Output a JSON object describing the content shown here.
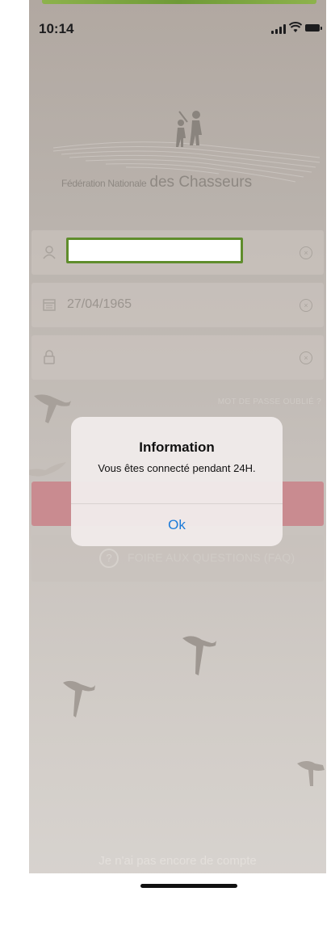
{
  "status_bar": {
    "time": "10:14"
  },
  "logo": {
    "text_small": "Fédération Nationale",
    "text_large": "des Chasseurs"
  },
  "form": {
    "username": {
      "value": ""
    },
    "birthdate": {
      "value": "27/04/1965"
    },
    "password": {
      "value": ""
    },
    "forgot_password": "MOT DE PASSE OUBLIÉ ?",
    "faq_button": "FOIRE AUX QUESTIONS (FAQ)"
  },
  "dialog": {
    "title": "Information",
    "message": "Vous êtes connecté pendant 24H.",
    "ok_label": "Ok"
  },
  "footer": {
    "no_account": "Je n'ai pas encore de compte"
  },
  "colors": {
    "accent_green": "#5f8d2c",
    "login_red": "#c98b90",
    "link_blue": "#1a7ad9"
  }
}
